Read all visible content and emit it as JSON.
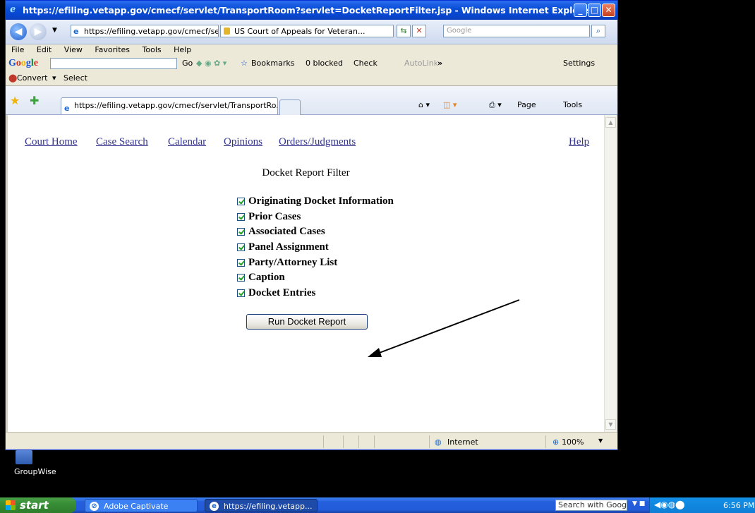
{
  "window": {
    "title": "https://efiling.vetapp.gov/cmecf/servlet/TransportRoom?servlet=DocketReportFilter.jsp - Windows Internet Explorer"
  },
  "address_bar": {
    "url": "https://efiling.vetapp.gov/cmecf/servlet/Tr",
    "security_site": "US Court of Appeals for Veteran...",
    "search_placeholder": "Google"
  },
  "menu": [
    "File",
    "Edit",
    "View",
    "Favorites",
    "Tools",
    "Help"
  ],
  "google_toolbar": {
    "logo": "Google",
    "go": "Go",
    "bookmarks": "Bookmarks",
    "blocked": "0 blocked",
    "check": "Check",
    "autolink": "AutoLink",
    "more": "»",
    "settings": "Settings"
  },
  "convert_bar": {
    "convert": "Convert",
    "select": "Select"
  },
  "tab": {
    "label": "https://efiling.vetapp.gov/cmecf/servlet/TransportRo...",
    "page_menu": "Page",
    "tools_menu": "Tools"
  },
  "nav_links": [
    "Court Home",
    "Case Search",
    "Calendar",
    "Opinions",
    "Orders/Judgments"
  ],
  "help_link": "Help",
  "page_title": "Docket Report Filter",
  "options": [
    {
      "label": "Originating Docket Information",
      "checked": true
    },
    {
      "label": "Prior Cases",
      "checked": true
    },
    {
      "label": "Associated Cases",
      "checked": true
    },
    {
      "label": "Panel Assignment",
      "checked": true
    },
    {
      "label": "Party/Attorney List",
      "checked": true
    },
    {
      "label": "Caption",
      "checked": true
    },
    {
      "label": "Docket Entries",
      "checked": true
    }
  ],
  "run_button": "Run Docket Report",
  "status_bar": {
    "zone": "Internet",
    "zoom": "100%"
  },
  "desktop": {
    "icon_label": "GroupWise"
  },
  "taskbar": {
    "start": "start",
    "items": [
      "Adobe Captivate",
      "https://efiling.vetapp..."
    ],
    "search": "Search with Google",
    "clock": "6:56 PM"
  },
  "colors": {
    "link": "#33348e",
    "titlebar": "#0a4fd6",
    "taskbar": "#245edc",
    "arrow": "#000000"
  }
}
